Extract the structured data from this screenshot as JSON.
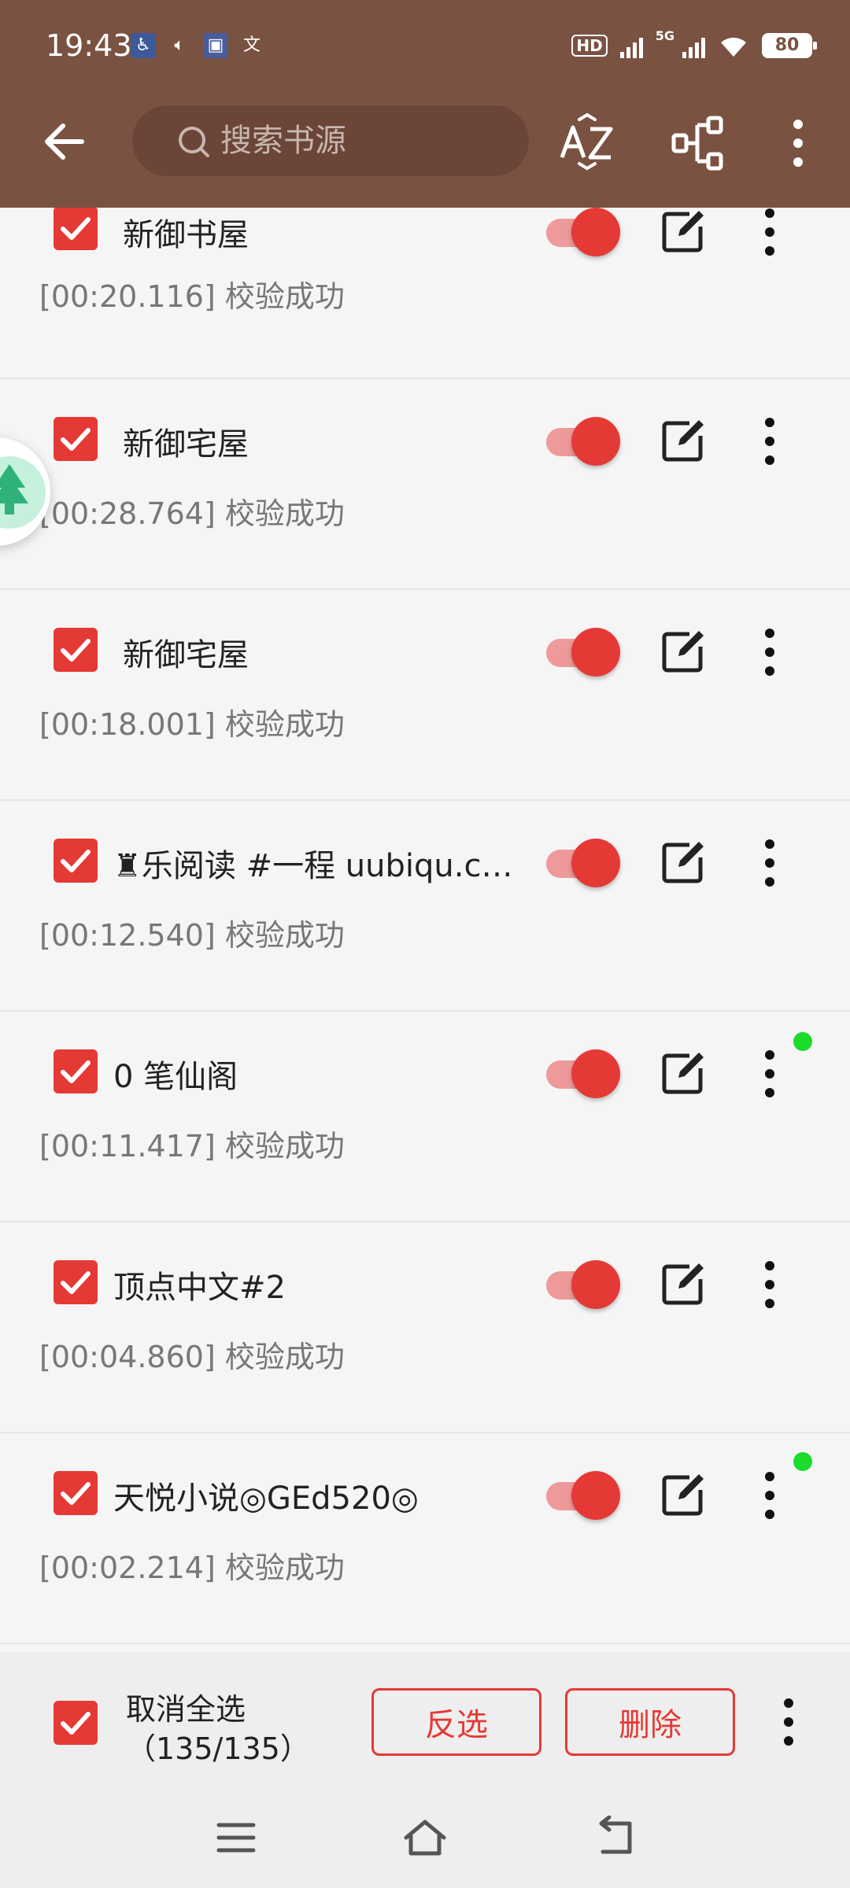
{
  "status_bar": {
    "time": "19:43",
    "network": "5G",
    "battery": "80"
  },
  "toolbar": {
    "search_placeholder": "搜索书源"
  },
  "colors": {
    "header": "#7a5242",
    "accent": "#e53935",
    "accent_light": "#ef9a9a",
    "dot": "#1bdc2a"
  },
  "sources": [
    {
      "name": "新御书屋",
      "status": "[00:20.116] 校验成功",
      "checked": true,
      "enabled": true
    },
    {
      "name": "新御宅屋",
      "status": "[00:28.764] 校验成功",
      "checked": true,
      "enabled": true
    },
    {
      "name": "新御宅屋",
      "status": "[00:18.001] 校验成功",
      "checked": true,
      "enabled": true
    },
    {
      "name": "♜乐阅读 #一程 uubiqu.c…",
      "status": "[00:12.540] 校验成功",
      "checked": true,
      "enabled": true
    },
    {
      "name": "0 笔仙阁",
      "status": "[00:11.417] 校验成功",
      "checked": true,
      "enabled": true
    },
    {
      "name": "顶点中文#2",
      "status": "[00:04.860] 校验成功",
      "checked": true,
      "enabled": true
    },
    {
      "name": "天悦小说◎GEd520◎",
      "status": "[00:02.214] 校验成功",
      "checked": true,
      "enabled": true
    }
  ],
  "bottom_bar": {
    "select_all_label": "取消全选",
    "count": "（135/135）",
    "invert_label": "反选",
    "delete_label": "删除"
  }
}
